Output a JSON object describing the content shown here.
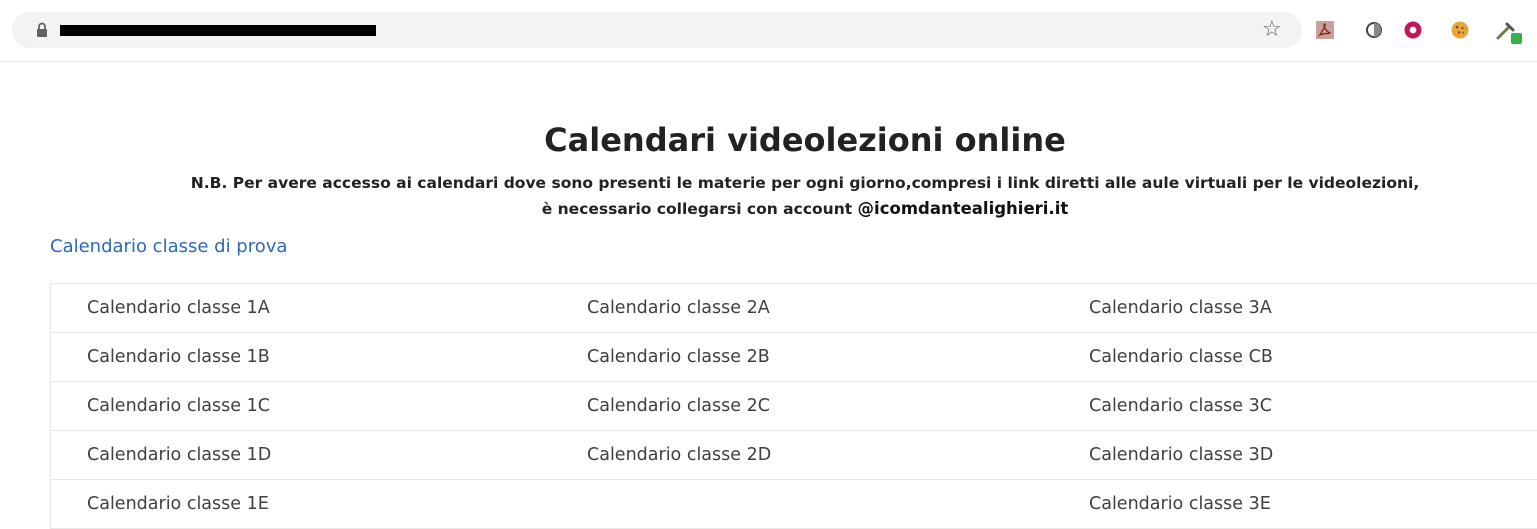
{
  "browser": {
    "address_bar": {
      "url_redacted": true
    },
    "bookmark_icon": "star-icon",
    "extensions": [
      "pdf-icon",
      "circle-icon",
      "donut-icon",
      "cookie-icon",
      "eyedropper-icon"
    ]
  },
  "page": {
    "title": "Calendari videolezioni online",
    "note_line1": "N.B. Per avere accesso ai calendari dove sono presenti le materie per ogni giorno,compresi i link diretti alle aule virtuali per le videolezioni,",
    "note_line2_prefix": "è necessario collegarsi con account ",
    "note_domain": "@icomdantealighieri.it",
    "test_link": "Calendario classe di prova",
    "rows": [
      [
        "Calendario classe 1A",
        "Calendario classe 2A",
        "Calendario classe 3A"
      ],
      [
        "Calendario classe 1B",
        "Calendario classe 2B",
        "Calendario classe CB"
      ],
      [
        "Calendario classe 1C",
        "Calendario classe 2C",
        "Calendario classe 3C"
      ],
      [
        "Calendario classe 1D",
        "Calendario classe 2D",
        "Calendario classe 3D"
      ],
      [
        "Calendario classe 1E",
        "",
        "Calendario classe 3E"
      ]
    ]
  },
  "colors": {
    "link": "#2d6ab8",
    "text": "#404040",
    "heading": "#222222"
  }
}
